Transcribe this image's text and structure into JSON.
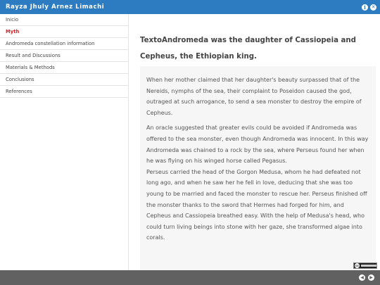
{
  "header": {
    "title": "Rayza Jhuly Arnez Limachi",
    "info_icon": "i",
    "close_icon": "✕"
  },
  "sidebar": {
    "items": [
      {
        "label": "Inicio",
        "active": false
      },
      {
        "label": "Myth",
        "active": true
      },
      {
        "label": "Andromeda constellation information",
        "active": false
      },
      {
        "label": "Result and Discussions",
        "active": false
      },
      {
        "label": "Materials & Methods",
        "active": false
      },
      {
        "label": "Conclusions",
        "active": false
      },
      {
        "label": "References",
        "active": false
      }
    ]
  },
  "main": {
    "heading": "TextoAndromeda was the daughter of Cassiopeia and Cepheus, the Ethiopian king.",
    "paragraphs": [
      "When her mother claimed that her daughter's beauty surpassed that of the Nereids, nymphs of the sea, their complaint to Poseidon caused the god, outraged at such arrogance, to send a sea monster to destroy the empire of Cepheus.",
      "An oracle suggested that greater evils could be avoided if Andromeda was offered to the sea monster, even though Andromeda was innocent. In this way Andromeda was chained to a rock by the sea, where Perseus found her when he was flying on his winged horse called Pegasus.",
      "Perseus carried the head of the Gorgon Medusa, whom he had defeated not long ago, and when he saw her he fell in love, deducing that she was too young to be married and faced the monster to rescue her. Perseus finished off the monster thanks to the sword that Hermes had forged for him, and Cepheus and Cassiopeia breathed easy. With the help of Medusa's head, who could turn living beings into stone with her gaze, she transformed algae into corals."
    ]
  },
  "license_badge": {
    "text": "cc",
    "icon": "creative-commons-icon"
  },
  "footer": {
    "prev_icon": "◀",
    "next_icon": "▶"
  },
  "colors": {
    "header_bg": "#2d7cc1",
    "active_nav": "#d8232a",
    "footer_bg": "#616161",
    "content_box_bg": "#f6f6f6"
  }
}
